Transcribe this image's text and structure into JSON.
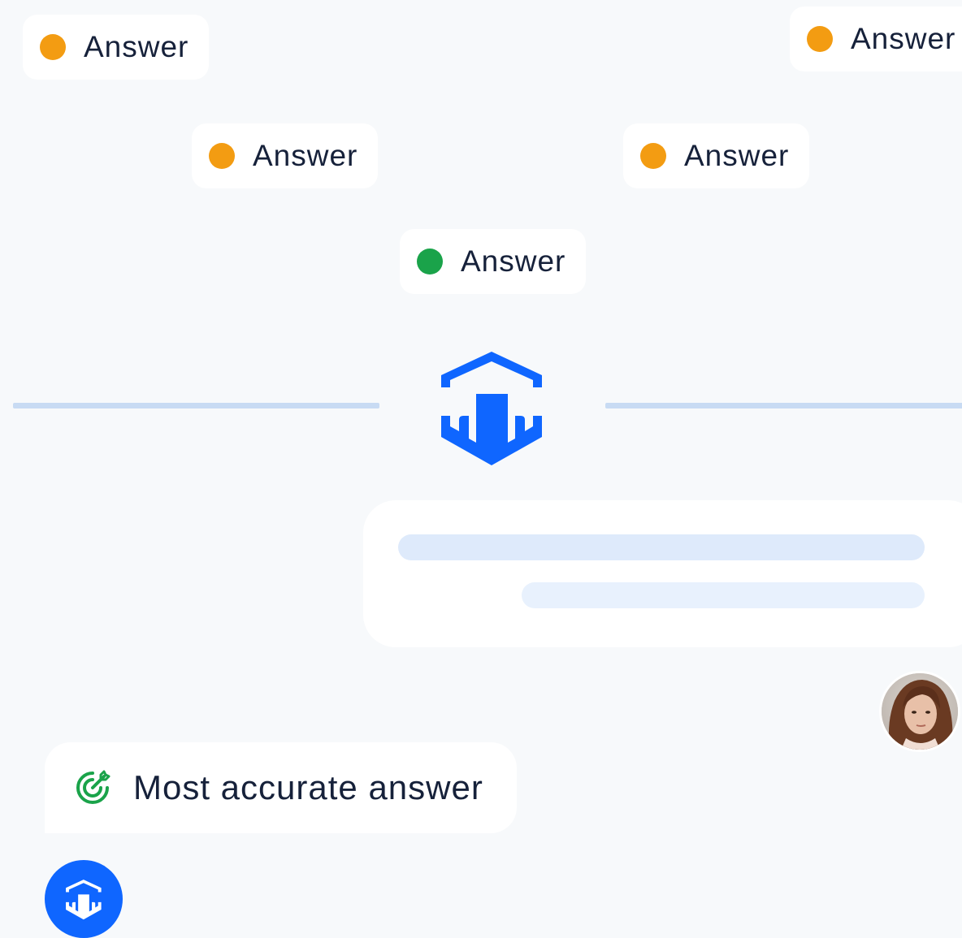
{
  "answers": [
    {
      "label": "Answer",
      "status_color": "#f39c12"
    },
    {
      "label": "Answer",
      "status_color": "#f39c12"
    },
    {
      "label": "Answer",
      "status_color": "#f39c12"
    },
    {
      "label": "Answer",
      "status_color": "#f39c12"
    },
    {
      "label": "Answer",
      "status_color": "#1aa34a"
    }
  ],
  "result": {
    "label": "Most accurate answer",
    "icon": "target-icon",
    "icon_color": "#1aa34a"
  },
  "brand": {
    "logo": "hexagon-logo-icon",
    "color": "#0f66ff"
  },
  "chat": {
    "line_color_1": "#deeafb",
    "line_color_2": "#e8f1fd"
  },
  "colors": {
    "background": "#f7f9fb",
    "connector_line": "#c8dbf3"
  }
}
